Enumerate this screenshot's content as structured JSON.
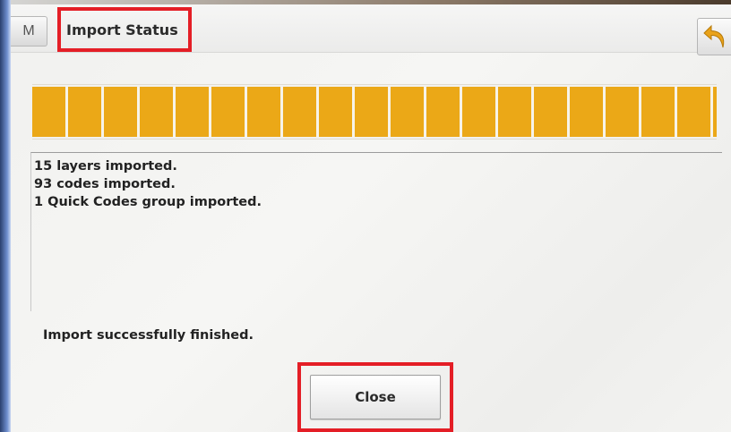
{
  "header": {
    "menu_icon": "menu-m-icon",
    "menu_glyph": "M",
    "title": "Import Status",
    "back_icon": "undo-arrow-icon"
  },
  "progress": {
    "fraction": 1.0,
    "color": "#eba817"
  },
  "log": {
    "lines": [
      "15 layers imported.",
      "93 codes imported.",
      "1 Quick Codes group imported."
    ]
  },
  "status": {
    "message": "Import successfully finished."
  },
  "actions": {
    "close_label": "Close"
  },
  "colors": {
    "highlight": "#e41e26",
    "progress": "#eba817"
  }
}
